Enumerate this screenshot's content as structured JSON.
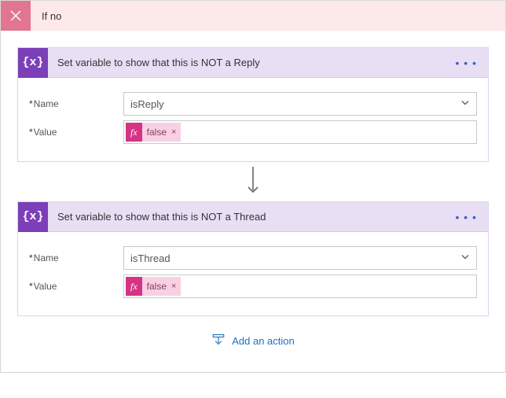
{
  "header": {
    "title": "If no"
  },
  "cards": [
    {
      "icon": "{x}",
      "title": "Set variable to show that this is NOT a Reply",
      "name_label": "Name",
      "name_value": "isReply",
      "value_label": "Value",
      "fx_value": "false"
    },
    {
      "icon": "{x}",
      "title": "Set variable to show that this is NOT a Thread",
      "name_label": "Name",
      "name_value": "isThread",
      "value_label": "Value",
      "fx_value": "false"
    }
  ],
  "footer": {
    "add_action": "Add an action"
  }
}
